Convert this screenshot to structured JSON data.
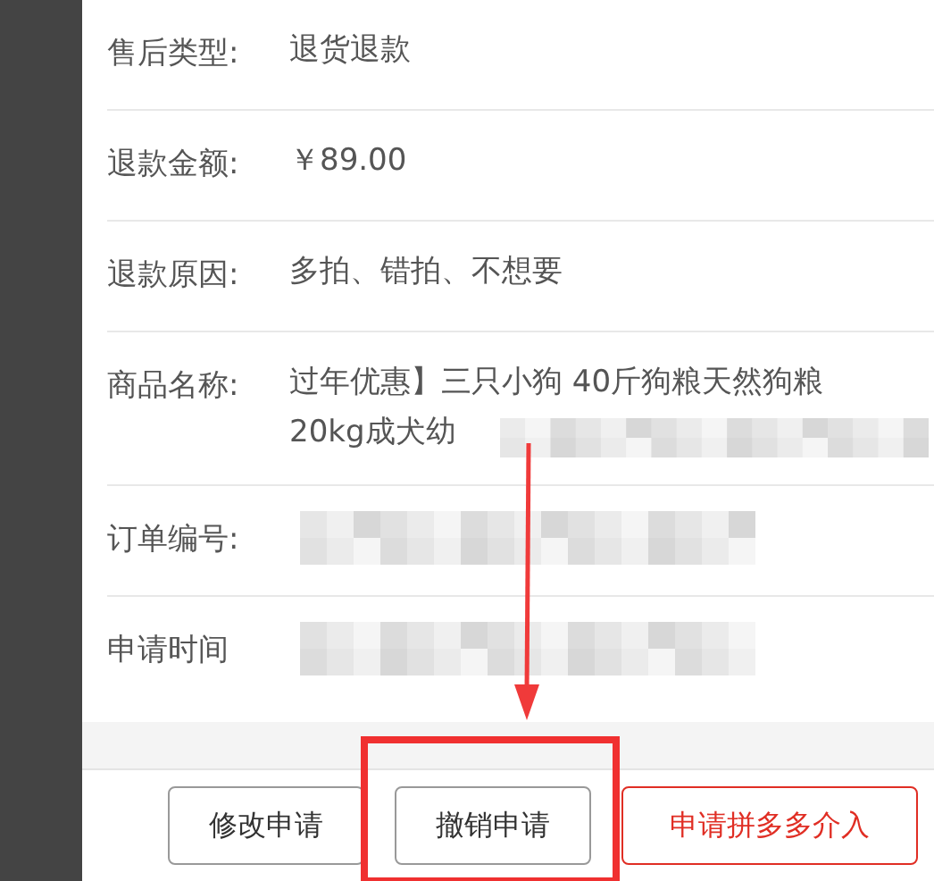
{
  "fields": [
    {
      "label": "售后类型:",
      "kind": "text",
      "lines": [
        "退货退款"
      ]
    },
    {
      "label": "退款金额:",
      "kind": "text",
      "lines": [
        "￥89.00"
      ]
    },
    {
      "label": "退款原因:",
      "kind": "text",
      "lines": [
        "多拍、错拍、不想要"
      ]
    },
    {
      "label": "商品名称:",
      "kind": "partly_redacted",
      "lines": [
        "过年优惠】三只小狗 40斤狗粮天然狗粮",
        "20kg成犬幼"
      ]
    },
    {
      "label": "订单编号:",
      "kind": "redacted"
    },
    {
      "label": "申请时间",
      "kind": "redacted"
    }
  ],
  "buttons": [
    {
      "label": "修改申请",
      "kind": "outline"
    },
    {
      "label": "撤销申请",
      "kind": "outline"
    },
    {
      "label": "申请拼多多介入",
      "kind": "primary"
    }
  ]
}
